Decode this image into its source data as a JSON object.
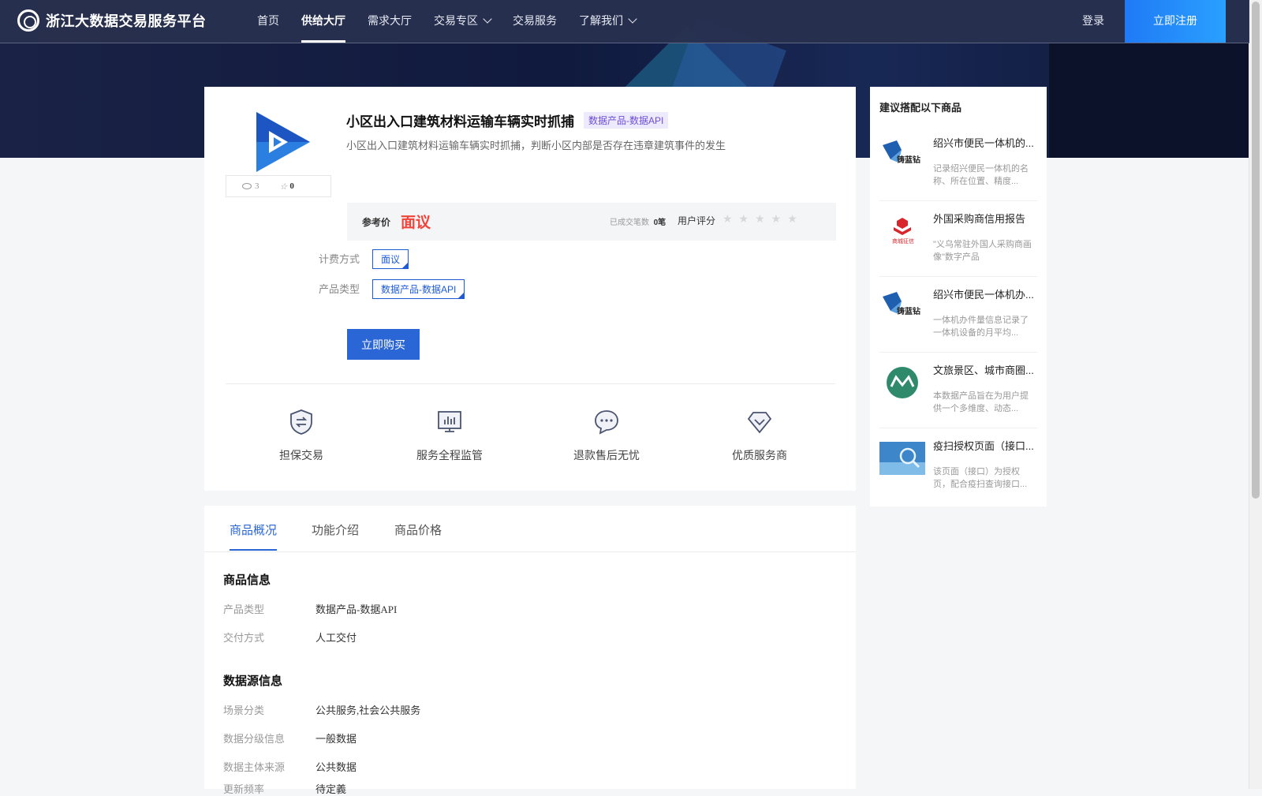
{
  "nav": {
    "brand": "浙江大数据交易服务平台",
    "items": [
      {
        "label": "首页",
        "active": false,
        "dropdown": false
      },
      {
        "label": "供给大厅",
        "active": true,
        "dropdown": false
      },
      {
        "label": "需求大厅",
        "active": false,
        "dropdown": false
      },
      {
        "label": "交易专区",
        "active": false,
        "dropdown": true
      },
      {
        "label": "交易服务",
        "active": false,
        "dropdown": false
      },
      {
        "label": "了解我们",
        "active": false,
        "dropdown": true
      }
    ],
    "login": "登录",
    "register": "立即注册"
  },
  "product": {
    "title": "小区出入口建筑材料运输车辆实时抓捕",
    "tag": "数据产品-数据API",
    "description": "小区出入口建筑材料运输车辆实时抓捕，判断小区内部是否存在违章建筑事件的发生",
    "views": "3",
    "favorites": "0",
    "price_label": "参考价",
    "price_value": "面议",
    "deals_label": "已成交笔数",
    "deals_value": "0笔",
    "rating_label": "用户评分",
    "rating_stars": "★★★★★",
    "billing_label": "计费方式",
    "billing_option": "面议",
    "type_label": "产品类型",
    "type_option": "数据产品-数据API",
    "buy_label": "立即购买"
  },
  "guarantees": [
    {
      "label": "担保交易",
      "icon": "shield-exchange-icon"
    },
    {
      "label": "服务全程监管",
      "icon": "monitor-chart-icon"
    },
    {
      "label": "退款售后无忧",
      "icon": "chat-bubble-icon"
    },
    {
      "label": "优质服务商",
      "icon": "diamond-check-icon"
    }
  ],
  "sidebar": {
    "title": "建议搭配以下商品",
    "items": [
      {
        "name": "绍兴市便民一体机的...",
        "desc": "记录绍兴便民一体机的名称、所在位置、精度...",
        "logo_color": "#1f5fb0"
      },
      {
        "name": "外国采购商信用报告",
        "desc": "\"义乌常驻外国人采购商画像\"数字产品",
        "logo_color": "#d8262c"
      },
      {
        "name": "绍兴市便民一体机办...",
        "desc": "一体机办件量信息记录了一体机设备的月平均...",
        "logo_color": "#1f5fb0"
      },
      {
        "name": "文旅景区、城市商圈...",
        "desc": "本数据产品旨在为用户提供一个多维度、动态...",
        "logo_color": "#2e8a6a"
      },
      {
        "name": "疫扫授权页面（接口...",
        "desc": "该页面（接口）为授权页，配合疫扫查询接口...",
        "logo_color": "#3d86c9"
      }
    ]
  },
  "detail": {
    "tabs": [
      "商品概况",
      "功能介绍",
      "商品价格"
    ],
    "sections": [
      {
        "title": "商品信息",
        "rows": [
          {
            "key": "产品类型",
            "value": "数据产品-数据API"
          },
          {
            "key": "交付方式",
            "value": "人工交付"
          }
        ]
      },
      {
        "title": "数据源信息",
        "rows": [
          {
            "key": "场景分类",
            "value": "公共服务,社会公共服务"
          },
          {
            "key": "数据分级信息",
            "value": "一般数据"
          },
          {
            "key": "数据主体来源",
            "value": "公共数据"
          },
          {
            "key": "更新频率",
            "value": "待定義"
          }
        ]
      }
    ]
  },
  "colors": {
    "accent": "#2b66d6",
    "price": "#f0443a",
    "tag_bg": "#eeeafd"
  }
}
